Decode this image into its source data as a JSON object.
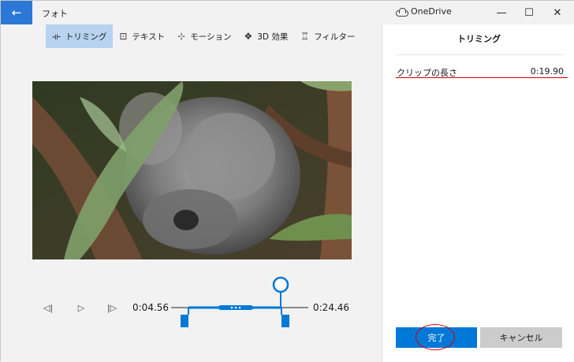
{
  "titlebar": {
    "back_icon": "back-arrow-icon",
    "app_title": "フォト",
    "onedrive_label": "OneDrive",
    "minimize": "—",
    "maximize": "☐",
    "close": "✕"
  },
  "toolbar": {
    "items": [
      {
        "label": "トリミング",
        "icon": "trim-icon",
        "glyph": "⟛"
      },
      {
        "label": "テキスト",
        "icon": "text-icon",
        "glyph": "⊡"
      },
      {
        "label": "モーション",
        "icon": "motion-icon",
        "glyph": "⊹"
      },
      {
        "label": "3D 効果",
        "icon": "3d-effects-icon",
        "glyph": "❖"
      },
      {
        "label": "フィルター",
        "icon": "filter-icon",
        "glyph": "♖"
      }
    ],
    "active_index": 0
  },
  "player": {
    "prev_frame_glyph": "◁|",
    "play_glyph": "▷",
    "next_frame_glyph": "|▷",
    "start_time": "0:04.56",
    "end_time": "0:24.46"
  },
  "panel": {
    "title": "トリミング",
    "clip_length_label": "クリップの長さ",
    "clip_length_value": "0:19.90",
    "done_label": "完了",
    "cancel_label": "キャンセル"
  },
  "colors": {
    "accent": "#0078d7",
    "back_button": "#2b78d6",
    "annotation_red": "#d40000",
    "active_tool_bg": "#b7d3f0"
  }
}
